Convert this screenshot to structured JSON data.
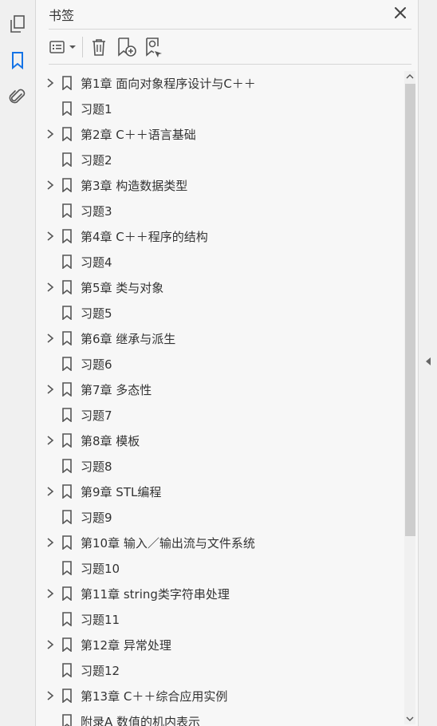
{
  "rail": {
    "items": [
      {
        "icon": "pages-icon"
      },
      {
        "icon": "bookmark-icon",
        "active": true
      },
      {
        "icon": "attachment-icon"
      }
    ]
  },
  "panel": {
    "title": "书签",
    "toolbar": {
      "options": "options-menu-icon",
      "delete": "trash-icon",
      "new_bookmark": "new-bookmark-icon",
      "find_bookmark": "find-bookmark-icon"
    }
  },
  "bookmarks": [
    {
      "label": "第1章 面向对象程序设计与C＋＋",
      "expandable": true
    },
    {
      "label": "习题1",
      "expandable": false
    },
    {
      "label": "第2章 C＋＋语言基础",
      "expandable": true
    },
    {
      "label": "习题2",
      "expandable": false
    },
    {
      "label": "第3章 构造数据类型",
      "expandable": true
    },
    {
      "label": "习题3",
      "expandable": false
    },
    {
      "label": "第4章 C＋＋程序的结构",
      "expandable": true
    },
    {
      "label": "习题4",
      "expandable": false
    },
    {
      "label": "第5章 类与对象",
      "expandable": true
    },
    {
      "label": "习题5",
      "expandable": false
    },
    {
      "label": "第6章 继承与派生",
      "expandable": true
    },
    {
      "label": "习题6",
      "expandable": false
    },
    {
      "label": "第7章 多态性",
      "expandable": true
    },
    {
      "label": "习题7",
      "expandable": false
    },
    {
      "label": "第8章 模板",
      "expandable": true
    },
    {
      "label": "习题8",
      "expandable": false
    },
    {
      "label": "第9章 STL编程",
      "expandable": true
    },
    {
      "label": "习题9",
      "expandable": false
    },
    {
      "label": "第10章 输入／输出流与文件系统",
      "expandable": true
    },
    {
      "label": "习题10",
      "expandable": false
    },
    {
      "label": "第11章 string类字符串处理",
      "expandable": true
    },
    {
      "label": "习题11",
      "expandable": false
    },
    {
      "label": "第12章 异常处理",
      "expandable": true
    },
    {
      "label": "习题12",
      "expandable": false
    },
    {
      "label": "第13章 C＋＋综合应用实例",
      "expandable": true
    },
    {
      "label": "附录A 数值的机内表示",
      "expandable": false
    }
  ],
  "colors": {
    "accent": "#1473e6",
    "icon": "#555555",
    "text": "#333333"
  }
}
